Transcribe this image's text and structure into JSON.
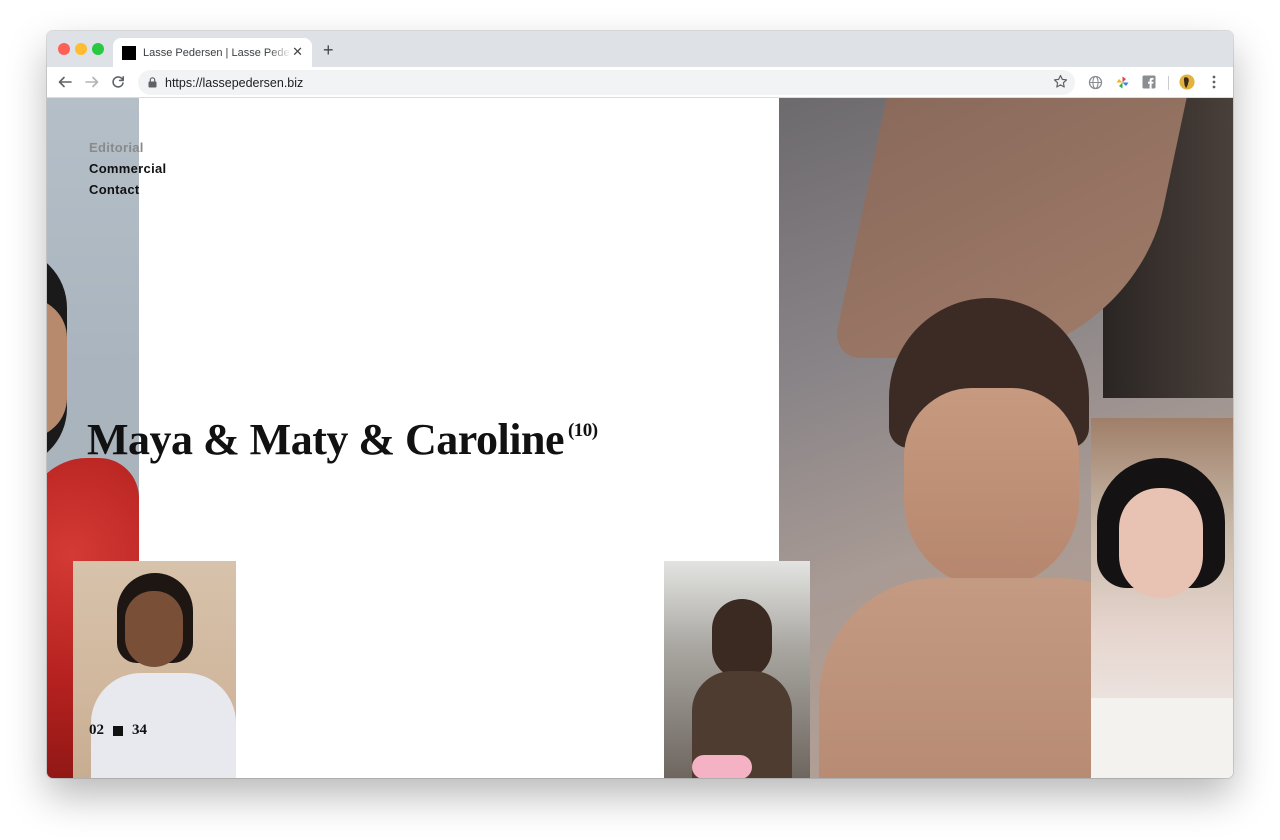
{
  "browser": {
    "tab_title": "Lasse Pedersen | Lasse Pedersen",
    "url": "https://lassepedersen.biz",
    "tab_close": "✕",
    "new_tab": "+"
  },
  "nav": {
    "items": [
      "Editorial",
      "Commercial",
      "Contact"
    ],
    "active": "Editorial"
  },
  "project": {
    "title": "Maya & Maty & Caroline",
    "count": "(10)"
  },
  "counter": {
    "current": "02",
    "total": "34"
  },
  "colors": {
    "text": "#111111",
    "muted_nav": "#8a8a8a",
    "background": "#ffffff"
  }
}
